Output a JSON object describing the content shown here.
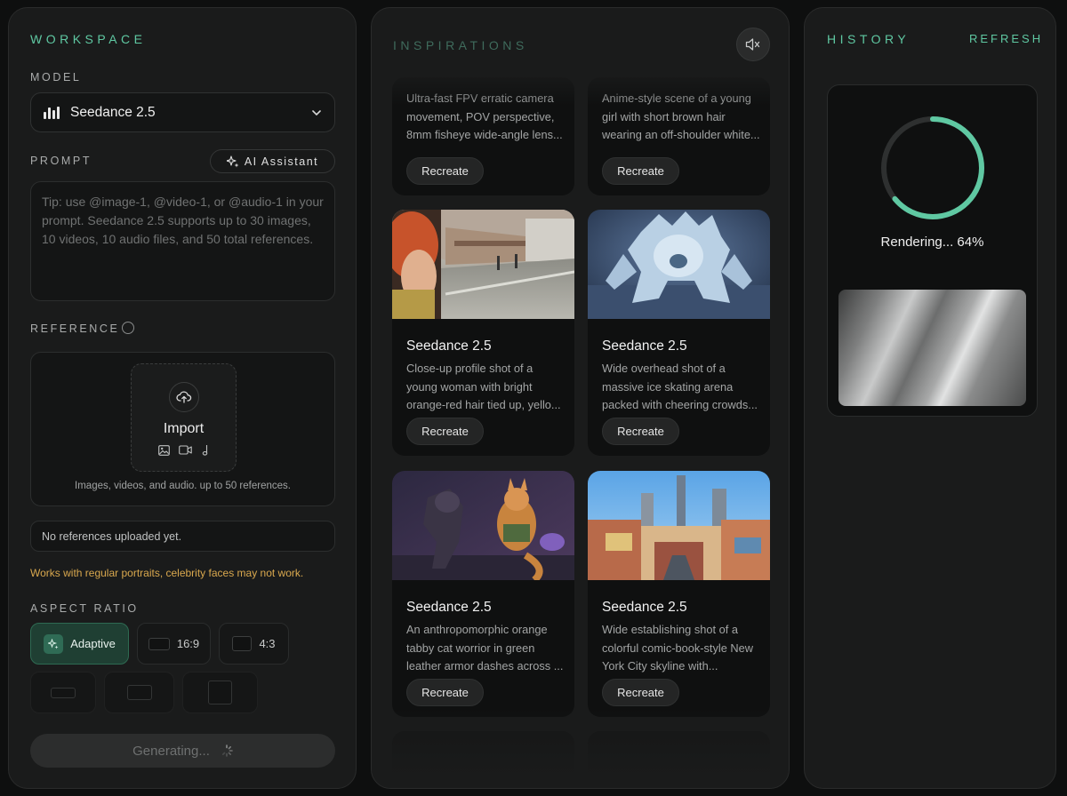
{
  "workspace": {
    "title": "WORKSPACE",
    "model_label": "MODEL",
    "model_value": "Seedance 2.5",
    "prompt_label": "PROMPT",
    "ai_assistant": "AI Assistant",
    "prompt_placeholder": "Tip: use @image-1, @video-1, or @audio-1 in your prompt. Seedance 2.5 supports up to 30 images, 10 videos, 10 audio files, and 50 total references.",
    "reference_label": "REFERENCE",
    "import_label": "Import",
    "reference_note": "Images, videos, and audio. up to 50 references.",
    "no_references": "No references uploaded yet.",
    "warning": "Works with regular portraits, celebrity faces may not work.",
    "warning_color": "#d9a84e",
    "aspect_label": "ASPECT RATIO",
    "aspect_options": [
      "Adaptive",
      "16:9",
      "4:3"
    ],
    "aspect_selected": "Adaptive",
    "generate_button": "Generating..."
  },
  "inspirations": {
    "title": "INSPIRATIONS",
    "cards": [
      {
        "title": "",
        "desc": "Ultra-fast FPV erratic camera movement, POV perspective, 8mm fisheye wide-angle lens...",
        "button": "Recreate"
      },
      {
        "title": "",
        "desc": "Anime-style scene of a young girl with short brown hair wearing an off-shoulder white...",
        "button": "Recreate"
      },
      {
        "title": "Seedance 2.5",
        "desc": "Close-up profile shot of a young woman with bright orange-red hair tied up, yello...",
        "button": "Recreate"
      },
      {
        "title": "Seedance 2.5",
        "desc": "Wide overhead shot of a massive ice skating arena packed with cheering crowds...",
        "button": "Recreate"
      },
      {
        "title": "Seedance 2.5",
        "desc": "An anthropomorphic orange tabby cat worrior in green leather armor dashes across ...",
        "button": "Recreate"
      },
      {
        "title": "Seedance 2.5",
        "desc": "Wide establishing shot of a colorful comic-book-style New York City skyline with...",
        "button": "Recreate"
      }
    ]
  },
  "history": {
    "title": "HISTORY",
    "refresh": "REFRESH",
    "status": "Rendering... 64%",
    "progress": 0.64
  },
  "colors": {
    "accent": "#5fc8a2",
    "background": "#0e0f0f",
    "panel": "#1a1b1b"
  },
  "icons": [
    "bars-icon",
    "chevron-down-icon",
    "sparkles-icon",
    "info-icon",
    "cloud-upload-icon",
    "image-icon",
    "video-icon",
    "music-note-icon",
    "mute-icon",
    "spinner-icon"
  ]
}
